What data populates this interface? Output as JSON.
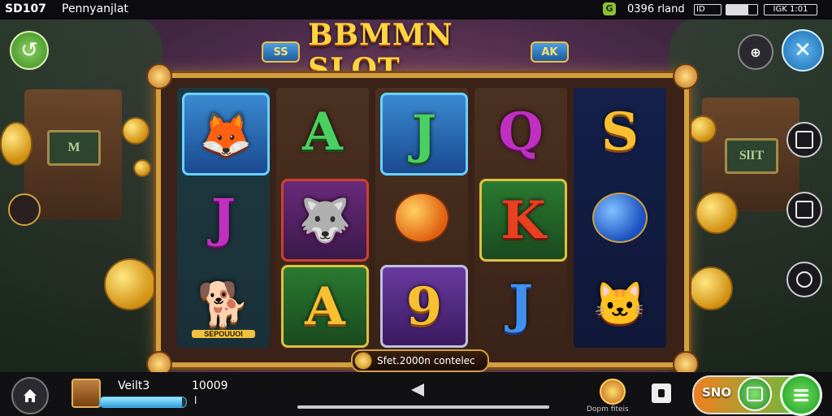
{
  "status_bar": {
    "time": "SD107",
    "app_name": "Pennyanjlat",
    "indicator": "G",
    "network": "0396 rland",
    "battery_label": "ID",
    "clock": "IGK 1:01",
    "battery_level": 0.7
  },
  "title": {
    "deco_left": "SS",
    "text": "BBMMN SLOT",
    "deco_right": "AK"
  },
  "reels": [
    [
      {
        "type": "animal",
        "glyph": "🦊",
        "style": "tile-boxed-blue",
        "color": "glyph-orange"
      },
      {
        "type": "letter",
        "glyph": "J",
        "style": "tile-plain",
        "color": "glyph-purple"
      },
      {
        "type": "animal",
        "glyph": "🐕",
        "style": "tile-plain",
        "color": "glyph-yellow",
        "caption": "SEPOUUOI"
      }
    ],
    [
      {
        "type": "letter",
        "glyph": "A",
        "style": "tile-plain",
        "color": "glyph-green"
      },
      {
        "type": "animal",
        "glyph": "🐺",
        "style": "tile-boxed-red",
        "color": "glyph-purple"
      },
      {
        "type": "letter",
        "glyph": "A",
        "style": "tile-boxed-green",
        "color": "glyph-yellow"
      }
    ],
    [
      {
        "type": "letter",
        "glyph": "J",
        "style": "tile-boxed-blue",
        "color": "glyph-green"
      },
      {
        "type": "orb",
        "style": "tile-plain",
        "orb": "orb-orange"
      },
      {
        "type": "letter",
        "glyph": "9",
        "style": "tile-boxed-purple",
        "color": "glyph-yellow"
      }
    ],
    [
      {
        "type": "letter",
        "glyph": "Q",
        "style": "tile-plain",
        "color": "glyph-purple"
      },
      {
        "type": "letter",
        "glyph": "K",
        "style": "tile-boxed-green",
        "color": "glyph-red"
      },
      {
        "type": "letter",
        "glyph": "J",
        "style": "tile-plain",
        "color": "glyph-blue"
      }
    ],
    [
      {
        "type": "letter",
        "glyph": "S",
        "style": "tile-plain",
        "color": "glyph-yellow"
      },
      {
        "type": "orb",
        "style": "tile-plain",
        "orb": "orb-blue"
      },
      {
        "type": "animal",
        "glyph": "🐱",
        "style": "tile-plain",
        "color": "glyph-orange"
      }
    ]
  ],
  "win_banner": "Sfet.2000n contelec",
  "hut_sign": "SlIT",
  "hut_sign_left": "M",
  "bottom_bar": {
    "balance_label": "Veilt3",
    "balance_value": "10009",
    "balance_fill": 0.95,
    "spin_progress": 1.0,
    "tick": "l",
    "bonus_label": "Dopm fiteis",
    "spin_label": "SNO"
  },
  "buttons": {
    "menu_icon": "⊕",
    "close_icon": "✕",
    "back_icon": "↺"
  }
}
